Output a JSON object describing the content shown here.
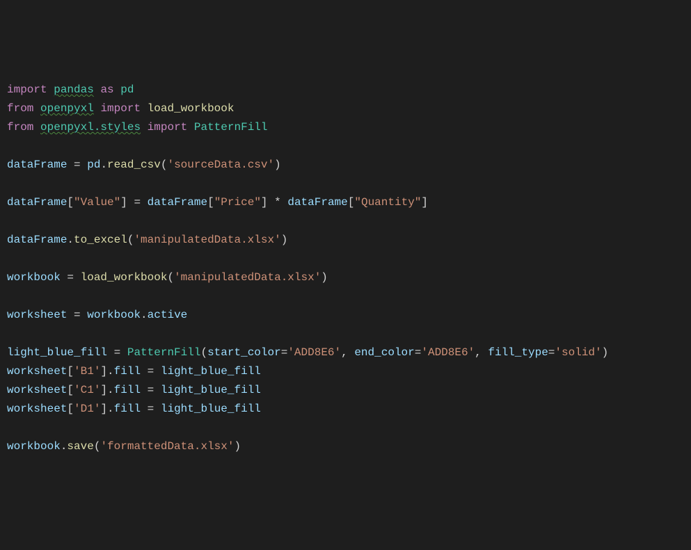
{
  "code": {
    "l1": {
      "kw1": "import",
      "mod": "pandas",
      "kw2": "as",
      "alias": "pd"
    },
    "l2": {
      "kw1": "from",
      "mod": "openpyxl",
      "kw2": "import",
      "name": "load_workbook"
    },
    "l3": {
      "kw1": "from",
      "mod": "openpyxl.styles",
      "kw2": "import",
      "name": "PatternFill"
    },
    "l5": {
      "var": "dataFrame",
      "eq": " = ",
      "obj": "pd",
      "dot": ".",
      "fn": "read_csv",
      "lp": "(",
      "str": "'sourceData.csv'",
      "rp": ")"
    },
    "l7": {
      "var": "dataFrame",
      "lb1": "[",
      "s1": "\"Value\"",
      "rb1": "]",
      "eq": " = ",
      "var2": "dataFrame",
      "lb2": "[",
      "s2": "\"Price\"",
      "rb2": "]",
      "op": " * ",
      "var3": "dataFrame",
      "lb3": "[",
      "s3": "\"Quantity\"",
      "rb3": "]"
    },
    "l9": {
      "var": "dataFrame",
      "dot": ".",
      "fn": "to_excel",
      "lp": "(",
      "str": "'manipulatedData.xlsx'",
      "rp": ")"
    },
    "l11": {
      "var": "workbook",
      "eq": " = ",
      "fn": "load_workbook",
      "lp": "(",
      "str": "'manipulatedData.xlsx'",
      "rp": ")"
    },
    "l13": {
      "var": "worksheet",
      "eq": " = ",
      "obj": "workbook",
      "dot": ".",
      "prop": "active"
    },
    "l15": {
      "var": "light_blue_fill",
      "eq": " = ",
      "cls": "PatternFill",
      "lp": "(",
      "p1": "start_color",
      "e1": "=",
      "s1": "'ADD8E6'",
      "c1": ", ",
      "p2": "end_color",
      "e2": "=",
      "s2": "'ADD8E6'",
      "c2": ", ",
      "p3": "fill_type",
      "e3": "=",
      "s3": "'solid'",
      "rp": ")"
    },
    "l16": {
      "obj": "worksheet",
      "lb": "[",
      "key": "'B1'",
      "rb": "]",
      "dot": ".",
      "prop": "fill",
      "eq": " = ",
      "val": "light_blue_fill"
    },
    "l17": {
      "obj": "worksheet",
      "lb": "[",
      "key": "'C1'",
      "rb": "]",
      "dot": ".",
      "prop": "fill",
      "eq": " = ",
      "val": "light_blue_fill"
    },
    "l18": {
      "obj": "worksheet",
      "lb": "[",
      "key": "'D1'",
      "rb": "]",
      "dot": ".",
      "prop": "fill",
      "eq": " = ",
      "val": "light_blue_fill"
    },
    "l20": {
      "obj": "workbook",
      "dot": ".",
      "fn": "save",
      "lp": "(",
      "str": "'formattedData.xlsx'",
      "rp": ")"
    }
  }
}
